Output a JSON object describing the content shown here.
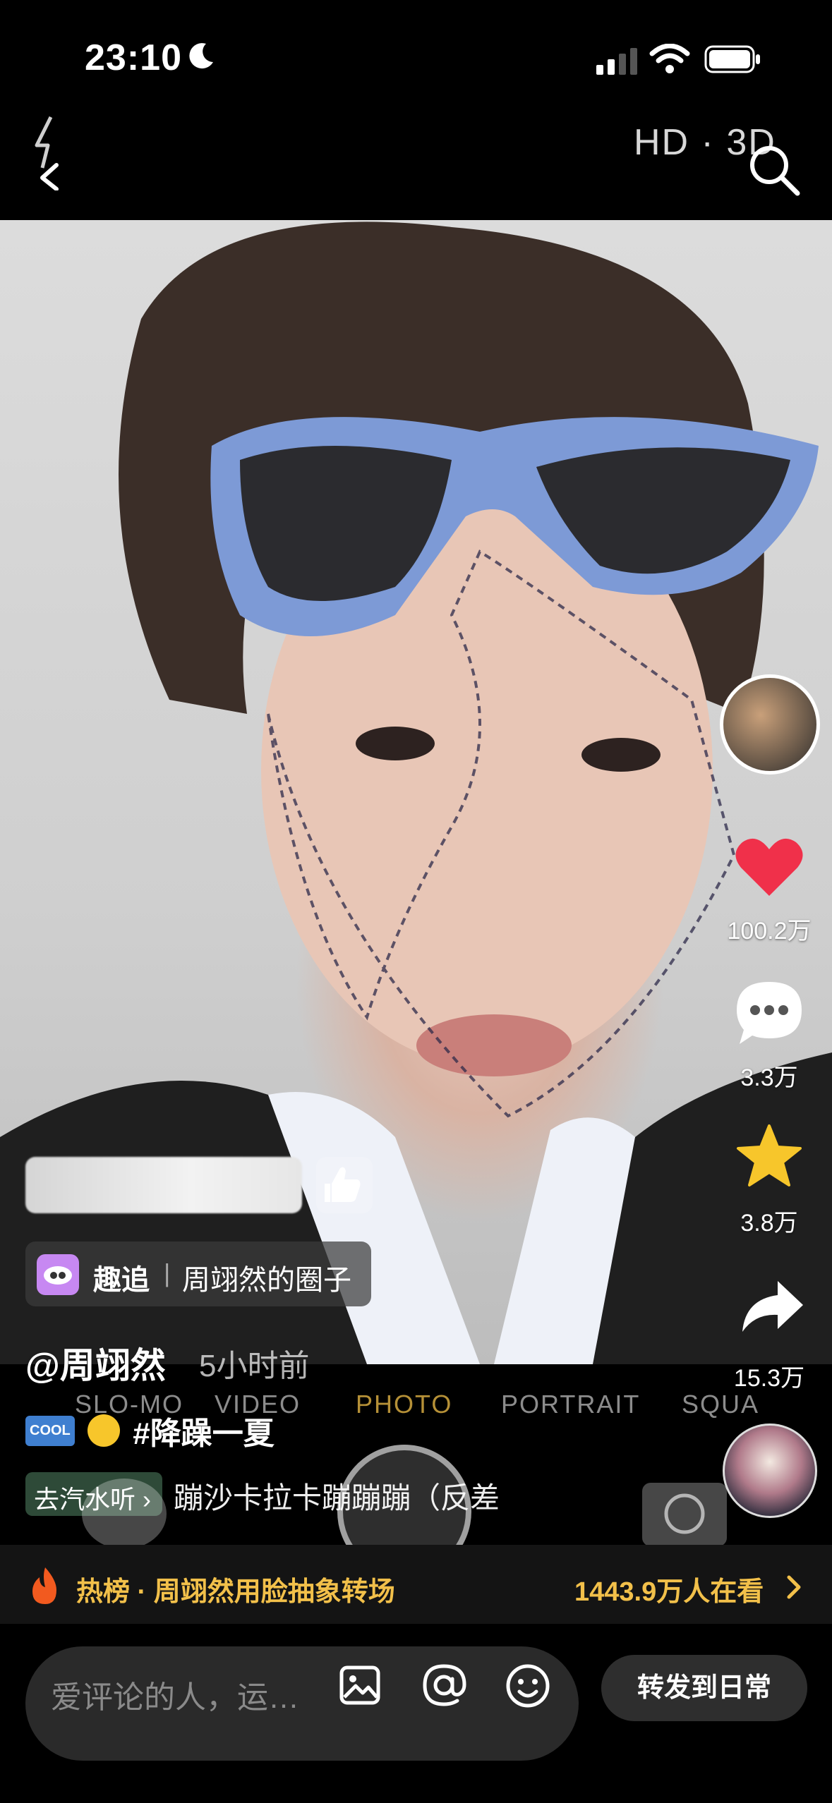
{
  "status_bar": {
    "time": "23:10"
  },
  "top_bar": {
    "quality_label": "HD · 3D"
  },
  "right_rail": {
    "likes": "100.2万",
    "comments": "3.3万",
    "favorites": "3.8万",
    "shares": "15.3万"
  },
  "circle_tag": {
    "app": "趣追",
    "name": "周翊然的圈子"
  },
  "author": {
    "handle": "@周翊然",
    "time_ago": "5小时前"
  },
  "camera_modes": [
    "SLO-MO",
    "VIDEO",
    "PHOTO",
    "PORTRAIT",
    "SQUA"
  ],
  "caption": {
    "badge": "COOL",
    "hashtag": "#降躁一夏"
  },
  "music": {
    "chip": "去汽水听 ›",
    "song": "蹦沙卡拉卡蹦蹦蹦（反差"
  },
  "hot_bar": {
    "text": "热榜 · 周翊然用脸抽象转场",
    "viewers": "1443.9万人在看"
  },
  "bottom": {
    "comment_placeholder": "爱评论的人，运…",
    "share_button": "转发到日常"
  },
  "colors": {
    "like": "#f0304a",
    "favorite": "#f7c62b",
    "hot": "#f2c04a"
  }
}
